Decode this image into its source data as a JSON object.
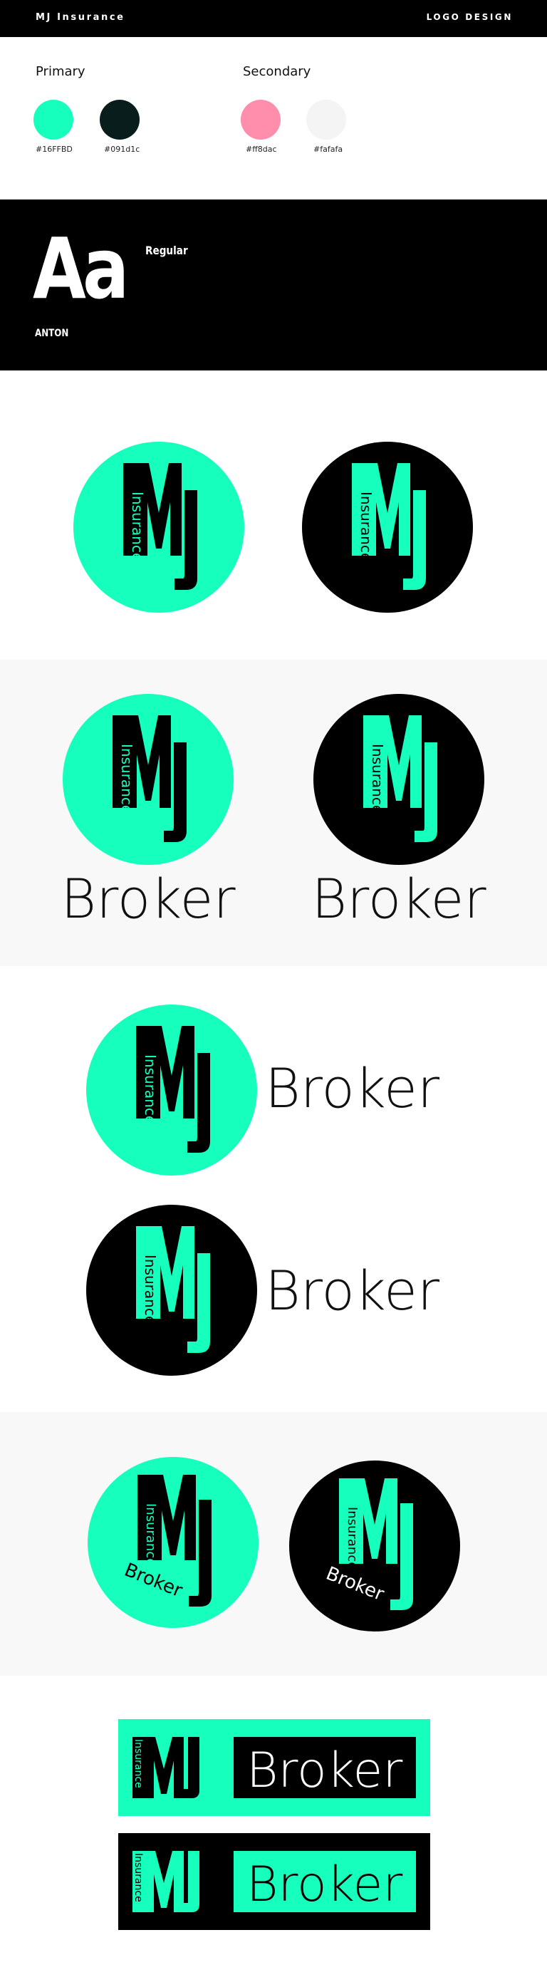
{
  "header": {
    "brand": "MJ Insurance",
    "section": "LOGO DESIGN"
  },
  "palette": {
    "primary_title": "Primary",
    "secondary_title": "Secondary",
    "primary": [
      {
        "label": "#16FFBD",
        "color": "#16ffbd"
      },
      {
        "label": "#091d1c",
        "color": "#091d1c"
      }
    ],
    "secondary": [
      {
        "label": "#ff8dac",
        "color": "#ff8dac"
      },
      {
        "label": "#fafafa",
        "color": "#fafafa"
      }
    ]
  },
  "typography": {
    "sample": "Aa",
    "weight": "Regular",
    "font_name": "ANTON"
  },
  "logo": {
    "monogram": "MJ",
    "vertical_word": "Insurance",
    "word": "Broker"
  },
  "colors": {
    "accent": "#16ffbd",
    "dark": "#000000"
  }
}
